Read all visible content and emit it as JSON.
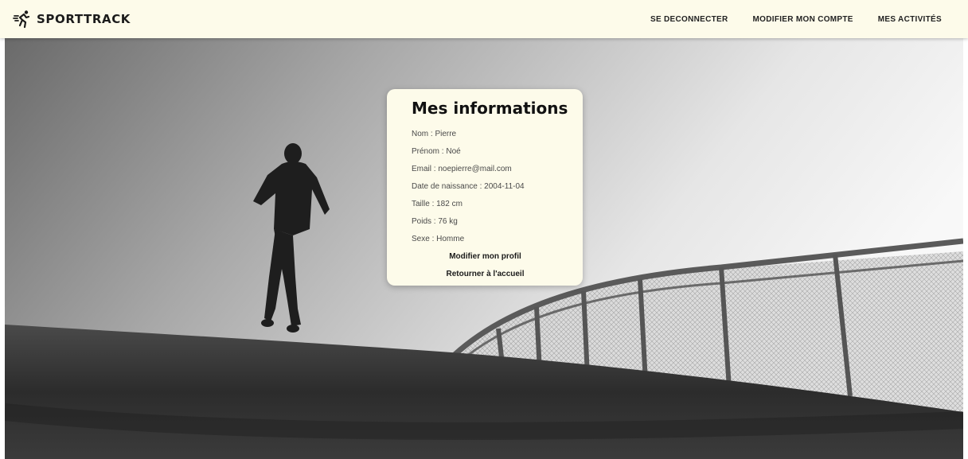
{
  "header": {
    "brand": "SPORTTRACK",
    "brand_icon": "running-man-icon",
    "nav": [
      {
        "label": "SE DECONNECTER"
      },
      {
        "label": "MODIFIER MON COMPTE"
      },
      {
        "label": "MES ACTIVITÉS"
      }
    ]
  },
  "hero": {
    "image": "black-and-white-photo-runner-on-bridge"
  },
  "card": {
    "title": "Mes informations",
    "fields": [
      {
        "text": "Nom : Pierre"
      },
      {
        "text": "Prénom : Noé"
      },
      {
        "text": "Email : noepierre@mail.com"
      },
      {
        "text": "Date de naissance : 2004-11-04"
      },
      {
        "text": "Taille : 182 cm"
      },
      {
        "text": "Poids : 76 kg"
      },
      {
        "text": "Sexe : Homme"
      }
    ],
    "edit_profile_label": "Modifier mon profil",
    "back_home_label": "Retourner à l'accueil"
  },
  "colors": {
    "navbar_bg": "#fdfbea",
    "card_bg": "#fdfbea",
    "text_dark": "#1b1b1b"
  }
}
